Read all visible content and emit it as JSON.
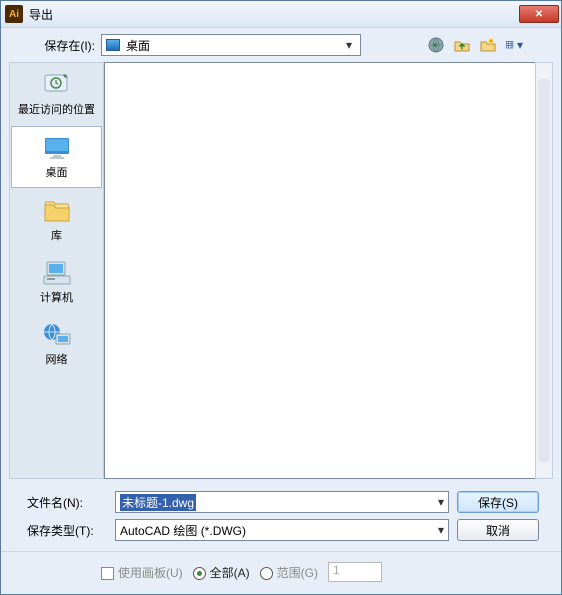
{
  "title": "导出",
  "save_in_label": "保存在(I):",
  "save_in_value": "桌面",
  "places": [
    {
      "id": "recent",
      "label": "最近访问的位置"
    },
    {
      "id": "desktop",
      "label": "桌面"
    },
    {
      "id": "library",
      "label": "库"
    },
    {
      "id": "computer",
      "label": "计算机"
    },
    {
      "id": "network",
      "label": "网络"
    }
  ],
  "filename_label": "文件名(N):",
  "filename_value": "未标题-1.dwg",
  "filetype_label": "保存类型(T):",
  "filetype_value": "AutoCAD 绘图 (*.DWG)",
  "save_button": "保存(S)",
  "cancel_button": "取消",
  "use_artboards_label": "使用画板(U)",
  "all_label": "全部(A)",
  "range_label": "范围(G)",
  "range_value": "1",
  "icons": {
    "back": "back-globe-icon",
    "up": "up-one-level-icon",
    "newfolder": "new-folder-icon",
    "views": "views-menu-icon"
  }
}
